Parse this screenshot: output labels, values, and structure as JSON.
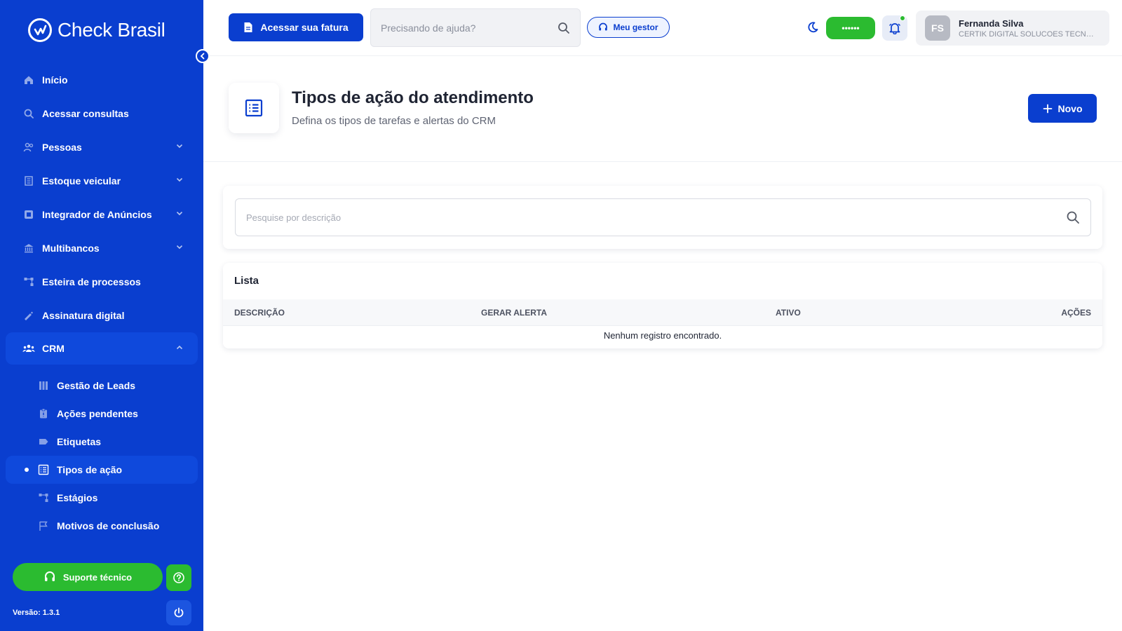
{
  "brand": {
    "name": "Check Brasil"
  },
  "sidebar": {
    "items": [
      {
        "label": "Início",
        "icon": "home-icon"
      },
      {
        "label": "Acessar consultas",
        "icon": "search-icon"
      },
      {
        "label": "Pessoas",
        "icon": "people-icon"
      },
      {
        "label": "Estoque veicular",
        "icon": "building-icon"
      },
      {
        "label": "Integrador de Anúncios",
        "icon": "ads-icon"
      },
      {
        "label": "Multibancos",
        "icon": "bank-icon"
      },
      {
        "label": "Esteira de processos",
        "icon": "flow-icon"
      },
      {
        "label": "Assinatura digital",
        "icon": "signature-icon"
      }
    ],
    "crm": {
      "label": "CRM",
      "sub": [
        {
          "label": "Gestão de Leads",
          "icon": "columns-icon"
        },
        {
          "label": "Ações pendentes",
          "icon": "clipboard-icon"
        },
        {
          "label": "Etiquetas",
          "icon": "tag-icon"
        },
        {
          "label": "Tipos de ação",
          "icon": "list-icon"
        },
        {
          "label": "Estágios",
          "icon": "flow-icon"
        },
        {
          "label": "Motivos de conclusão",
          "icon": "flag-icon"
        }
      ]
    },
    "support_label": "Suporte técnico",
    "version": "Versão: 1.3.1"
  },
  "topbar": {
    "fatura_label": "Acessar sua fatura",
    "help_placeholder": "Precisando de ajuda?",
    "gestor_label": "Meu gestor",
    "masked": "••••••",
    "user": {
      "initials": "FS",
      "name": "Fernanda Silva",
      "company": "CERTIK DIGITAL SOLUCOES TECNOLOGICAS"
    }
  },
  "page": {
    "title": "Tipos de ação do atendimento",
    "subtitle": "Defina os tipos de tarefas e alertas do CRM",
    "new_label": "Novo"
  },
  "search": {
    "placeholder": "Pesquise por descrição"
  },
  "list": {
    "title": "Lista",
    "columns": [
      "DESCRIÇÃO",
      "GERAR ALERTA",
      "ATIVO",
      "AÇÕES"
    ],
    "empty": "Nenhum registro encontrado."
  },
  "colors": {
    "primary": "#0a3ecf",
    "success": "#2bbb30"
  }
}
